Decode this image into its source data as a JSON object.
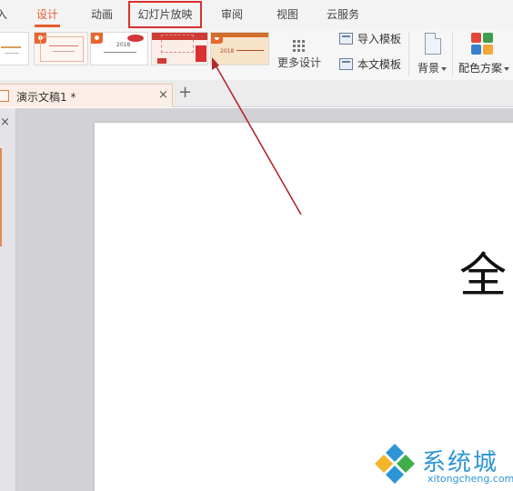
{
  "tabs": [
    {
      "label": "入",
      "active": false
    },
    {
      "label": "设计",
      "active": true
    },
    {
      "label": "动画",
      "active": false
    },
    {
      "label": "幻灯片放映",
      "active": false,
      "highlighted": true
    },
    {
      "label": "审阅",
      "active": false
    },
    {
      "label": "视图",
      "active": false
    },
    {
      "label": "云服务",
      "active": false
    }
  ],
  "ribbon": {
    "template_thumbnails": [
      {
        "year": ""
      },
      {
        "year": ""
      },
      {
        "year": "2018"
      },
      {
        "year": ""
      },
      {
        "year": "2018"
      }
    ],
    "more_design_label": "更多设计",
    "import_template_label": "导入模板",
    "this_template_label": "本文模板",
    "background_label": "背景",
    "color_scheme_label": "配色方案"
  },
  "document": {
    "tab_title": "演示文稿1 *",
    "close_glyph": "×",
    "add_glyph": "+"
  },
  "sidebar": {
    "close_glyph": "×"
  },
  "slide": {
    "visible_text": "全"
  },
  "annotation": {
    "color": "#b0292c",
    "target": "幻灯片放映"
  },
  "watermark": {
    "name": "系统城",
    "url": "xitongcheng.com"
  },
  "colors": {
    "accent": "#e55e2b",
    "highlight_box": "#d8312f",
    "watermark_blue": "#2d95d6"
  }
}
